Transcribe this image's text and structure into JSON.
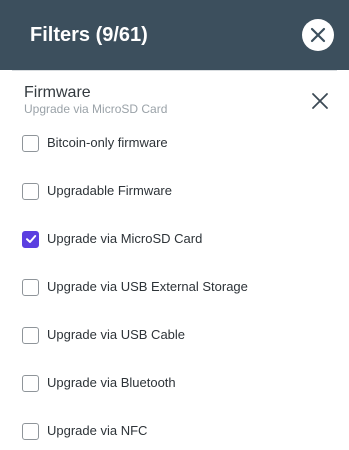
{
  "header": {
    "title": "Filters (9/61)",
    "close_icon": "close-icon"
  },
  "section": {
    "title": "Firmware",
    "subtitle": "Upgrade via MicroSD Card",
    "clear_icon": "close-icon"
  },
  "options": [
    {
      "label": "Bitcoin-only firmware",
      "checked": false
    },
    {
      "label": "Upgradable Firmware",
      "checked": false
    },
    {
      "label": "Upgrade via MicroSD Card",
      "checked": true
    },
    {
      "label": "Upgrade via USB External Storage",
      "checked": false
    },
    {
      "label": "Upgrade via USB Cable",
      "checked": false
    },
    {
      "label": "Upgrade via Bluetooth",
      "checked": false
    },
    {
      "label": "Upgrade via NFC",
      "checked": false
    }
  ],
  "colors": {
    "header_bg": "#3c4f5d",
    "accent": "#5b3fe0"
  }
}
